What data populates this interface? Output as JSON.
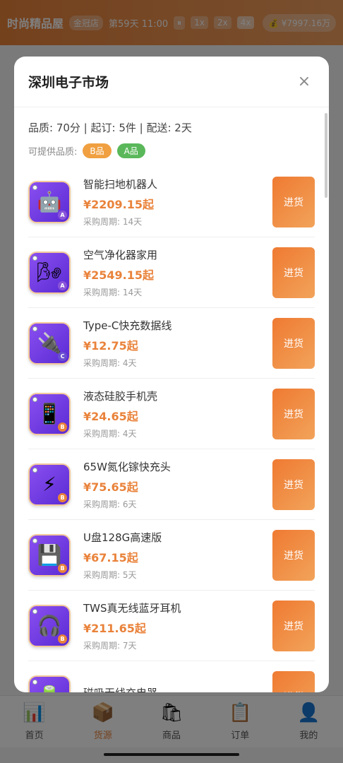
{
  "header": {
    "shop_name": "时尚精品屋",
    "rank": "金冠店",
    "day_time": "第59天 11:00",
    "pause_icon": "pause-icon",
    "speeds": [
      "1x",
      "2x",
      "4x"
    ],
    "money": "¥7997.16万"
  },
  "modal": {
    "title": "深圳电子市场",
    "close": "×",
    "supplier_info": "品质: 70分 | 起订: 5件 | 配送: 2天",
    "quality_label": "可提供品质:",
    "tiers": [
      {
        "label": "B品",
        "color": "#f0a040"
      },
      {
        "label": "A品",
        "color": "#5ab85a"
      }
    ],
    "buy_label": "进货",
    "products": [
      {
        "name": "智能扫地机器人",
        "price": "¥2209.15起",
        "cycle": "采购周期: 14天",
        "icon": "robot-icon",
        "glyph": "🤖",
        "grade": "A"
      },
      {
        "name": "空气净化器家用",
        "price": "¥2549.15起",
        "cycle": "采购周期: 14天",
        "icon": "air-purifier-icon",
        "glyph": "🌬",
        "grade": "A"
      },
      {
        "name": "Type-C快充数据线",
        "price": "¥12.75起",
        "cycle": "采购周期: 4天",
        "icon": "plug-icon",
        "glyph": "🔌",
        "grade": "C"
      },
      {
        "name": "液态硅胶手机壳",
        "price": "¥24.65起",
        "cycle": "采购周期: 4天",
        "icon": "phone-icon",
        "glyph": "📱",
        "grade": "B"
      },
      {
        "name": "65W氮化镓快充头",
        "price": "¥75.65起",
        "cycle": "采购周期: 6天",
        "icon": "lightning-icon",
        "glyph": "⚡",
        "grade": "B"
      },
      {
        "name": "U盘128G高速版",
        "price": "¥67.15起",
        "cycle": "采购周期: 5天",
        "icon": "floppy-disk-icon",
        "glyph": "💾",
        "grade": "B"
      },
      {
        "name": "TWS真无线蓝牙耳机",
        "price": "¥211.65起",
        "cycle": "采购周期: 7天",
        "icon": "headphones-icon",
        "glyph": "🎧",
        "grade": "B"
      },
      {
        "name": "磁吸无线充电器",
        "price": "",
        "cycle": "",
        "icon": "battery-icon",
        "glyph": "🔋",
        "grade": ""
      }
    ]
  },
  "nav": [
    {
      "label": "首页",
      "icon": "chart-icon",
      "glyph": "📊",
      "active": false
    },
    {
      "label": "货源",
      "icon": "package-icon",
      "glyph": "📦",
      "active": true
    },
    {
      "label": "商品",
      "icon": "shopping-bag-icon",
      "glyph": "🛍",
      "active": false
    },
    {
      "label": "订单",
      "icon": "clipboard-icon",
      "glyph": "📋",
      "active": false
    },
    {
      "label": "我的",
      "icon": "user-icon",
      "glyph": "👤",
      "active": false
    }
  ],
  "colors": {
    "accent": "#e9823a",
    "grade_A": "#8a55d8",
    "grade_B": "#e9823a",
    "grade_C": "#6a4fd0"
  }
}
